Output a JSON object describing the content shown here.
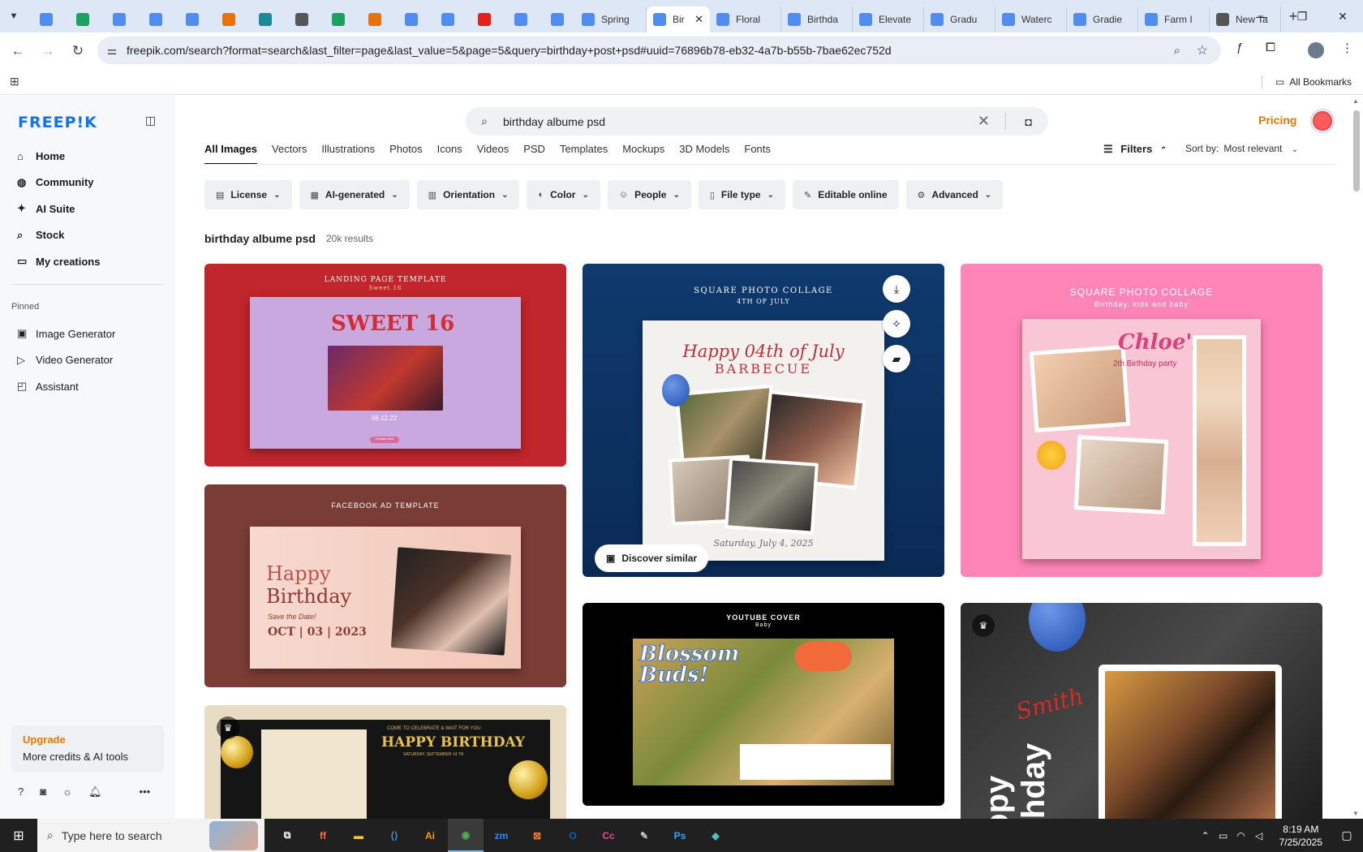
{
  "browser": {
    "tabs_pinned_count": 15,
    "titled_tabs": [
      {
        "label": "Spring",
        "fav_color": "#4f8df5"
      },
      {
        "label": "Bir",
        "fav_color": "#4f8df5",
        "active": true
      },
      {
        "label": "Floral",
        "fav_color": "#4f8df5"
      },
      {
        "label": "Birthda",
        "fav_color": "#4f8df5"
      },
      {
        "label": "Elevate",
        "fav_color": "#4f8df5"
      },
      {
        "label": "Gradu",
        "fav_color": "#4f8df5"
      },
      {
        "label": "Waterc",
        "fav_color": "#4f8df5"
      },
      {
        "label": "Gradie",
        "fav_color": "#4f8df5"
      },
      {
        "label": "Farm I",
        "fav_color": "#4f8df5"
      },
      {
        "label": "New Ta",
        "fav_color": "#555555"
      }
    ],
    "url": "freepik.com/search?format=search&last_filter=page&last_value=5&page=5&query=birthday+post+psd#uuid=76896b78-eb32-4a7b-b55b-7bae62ec752d",
    "bookmarks_label": "All Bookmarks"
  },
  "sidebar": {
    "logo": "FREEP!K",
    "nav": [
      {
        "label": "Home",
        "icon": "home-icon",
        "glyph": "⌂"
      },
      {
        "label": "Community",
        "icon": "globe-icon",
        "glyph": "◍"
      },
      {
        "label": "AI Suite",
        "icon": "sparkle-icon",
        "glyph": "✦"
      },
      {
        "label": "Stock",
        "icon": "search-icon",
        "glyph": "⌕"
      },
      {
        "label": "My creations",
        "icon": "folder-icon",
        "glyph": "▭"
      }
    ],
    "pinned_heading": "Pinned",
    "pinned": [
      {
        "label": "Image Generator",
        "icon": "image-icon",
        "glyph": "▣"
      },
      {
        "label": "Video Generator",
        "icon": "video-icon",
        "glyph": "▷"
      },
      {
        "label": "Assistant",
        "icon": "chat-icon",
        "glyph": "◰"
      }
    ],
    "upgrade_title": "Upgrade",
    "upgrade_sub": "More credits & AI tools"
  },
  "search": {
    "value": "birthday albume psd"
  },
  "header": {
    "pricing": "Pricing"
  },
  "type_tabs": [
    "All Images",
    "Vectors",
    "Illustrations",
    "Photos",
    "Icons",
    "Videos",
    "PSD",
    "Templates",
    "Mockups",
    "3D Models",
    "Fonts"
  ],
  "filters_label": "Filters",
  "sort": {
    "label": "Sort by:",
    "value": "Most relevant"
  },
  "chips": [
    {
      "label": "License",
      "icon": "license-icon",
      "glyph": "▤"
    },
    {
      "label": "AI-generated",
      "icon": "ai-icon",
      "glyph": "▦"
    },
    {
      "label": "Orientation",
      "icon": "orientation-icon",
      "glyph": "▥"
    },
    {
      "label": "Color",
      "icon": "palette-icon",
      "glyph": "◐"
    },
    {
      "label": "People",
      "icon": "people-icon",
      "glyph": "☺"
    },
    {
      "label": "File type",
      "icon": "file-icon",
      "glyph": "▯"
    },
    {
      "label": "Editable online",
      "icon": "pen-icon",
      "glyph": "✎",
      "no_caret": true
    },
    {
      "label": "Advanced",
      "icon": "gear-icon",
      "glyph": "⚙"
    }
  ],
  "results": {
    "title": "birthday albume psd",
    "count": "20k results"
  },
  "cards": {
    "c1": {
      "head": "LANDING PAGE TEMPLATE",
      "sub": "Sweet 16",
      "big": "SWEET 16",
      "date": "06.12.22",
      "btn": "Contact here"
    },
    "c2": {
      "head": "FACEBOOK AD TEMPLATE",
      "l1": "Happy",
      "l2": "Birthday",
      "l3": "Save the Date!",
      "l4": "OCT | 03 | 2023"
    },
    "c3": {
      "head": "COME TO CELEBRATE & WAIT FOR YOU",
      "big": "HAPPY BIRTHDAY",
      "sub": "SATURDAY, SEPTEMBER 14 TH"
    },
    "c4": {
      "head": "SQUARE PHOTO COLLAGE",
      "sub": "4TH OF JULY",
      "t1": "Happy 04th of July",
      "t2": "BARBECUE",
      "foot": "Saturday, July 4, 2025",
      "discover": "Discover similar"
    },
    "c5": {
      "head": "YOUTUBE COVER",
      "sub": "Baby",
      "big": "Blossom Buds!"
    },
    "c6": {
      "head": "SQUARE PHOTO COLLAGE",
      "sub": "Birthday, kids and baby",
      "t1": "Chloe's",
      "t2": "2th Birthday party"
    },
    "c7": {
      "big": "Happy Birthday",
      "script": "Smith"
    }
  },
  "taskbar": {
    "search_placeholder": "Type here to search",
    "time": "8:19 AM",
    "date": "7/25/2025",
    "apps": [
      {
        "name": "task-view-icon",
        "glyph": "⧉"
      },
      {
        "name": "firefox-icon",
        "glyph": "ff"
      },
      {
        "name": "file-explorer-icon",
        "glyph": "▬"
      },
      {
        "name": "vscode-icon",
        "glyph": "⟨⟩"
      },
      {
        "name": "illustrator-icon",
        "glyph": "Ai"
      },
      {
        "name": "chrome-icon",
        "glyph": "◉",
        "active": true
      },
      {
        "name": "zoom-icon",
        "glyph": "zm"
      },
      {
        "name": "xampp-icon",
        "glyph": "⊠"
      },
      {
        "name": "outlook-icon",
        "glyph": "O"
      },
      {
        "name": "creative-cloud-icon",
        "glyph": "Cc"
      },
      {
        "name": "pen-tool-icon",
        "glyph": "✎"
      },
      {
        "name": "photoshop-icon",
        "glyph": "Ps"
      },
      {
        "name": "app-icon",
        "glyph": "◆"
      }
    ]
  }
}
